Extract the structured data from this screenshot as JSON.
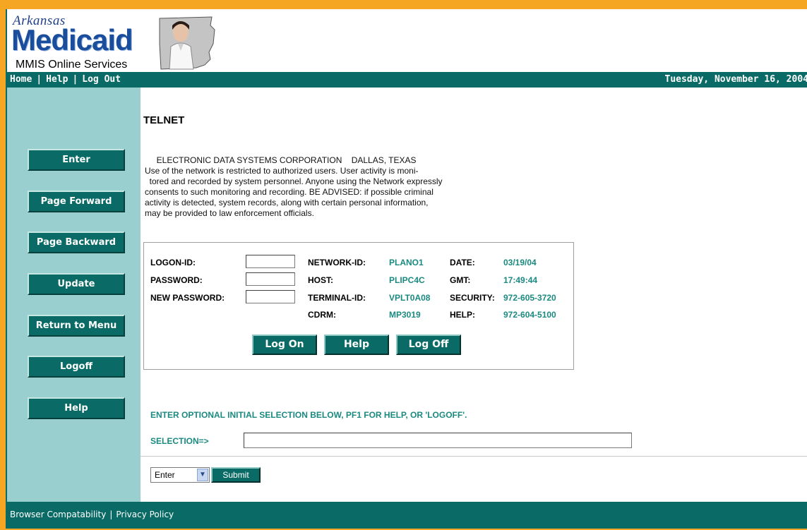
{
  "brand": {
    "script": "Arkansas",
    "name": "Medicaid",
    "subtitle": "MMIS Online Services"
  },
  "topbar": {
    "links": [
      "Home",
      "Help",
      "Log Out"
    ],
    "date": "Tuesday, November 16, 2004"
  },
  "sidebar": {
    "buttons": [
      "Enter",
      "Page Forward",
      "Page Backward",
      "Update",
      "Return to Menu",
      "Logoff",
      "Help"
    ]
  },
  "main": {
    "title": "TELNET",
    "notice": [
      "     ELECTRONIC DATA SYSTEMS CORPORATION    DALLAS, TEXAS",
      "Use of the network is restricted to authorized users. User activity is moni-",
      "  tored and recorded by system personnel. Anyone using the Network expressly",
      "consents to such monitoring and recording. BE ADVISED: if possible criminal",
      "activity is detected, system records, along with certain personal information,",
      "may be provided to law enforcement officials."
    ],
    "login": {
      "logon_id_label": "LOGON-ID:",
      "logon_id_value": "",
      "password_label": "PASSWORD:",
      "password_value": "",
      "new_password_label": "NEW PASSWORD:",
      "new_password_value": ""
    },
    "info": {
      "network_id_label": "NETWORK-ID:",
      "network_id": "PLANO1",
      "host_label": "HOST:",
      "host": "PLIPC4C",
      "terminal_id_label": "TERMINAL-ID:",
      "terminal_id": "VPLT0A08",
      "cdrm_label": "CDRM:",
      "cdrm": "MP3019",
      "date_label": "DATE:",
      "date": "03/19/04",
      "gmt_label": "GMT:",
      "gmt": "17:49:44",
      "security_label": "SECURITY:",
      "security": "972-605-3720",
      "help_label": "HELP:",
      "help": "972-604-5100"
    },
    "buttons": {
      "log_on": "Log On",
      "help": "Help",
      "log_off": "Log Off"
    },
    "prompt": "ENTER OPTIONAL INITIAL SELECTION BELOW, PF1 FOR HELP, OR 'LOGOFF'.",
    "selection_label": "SELECTION=>",
    "selection_value": "",
    "action_select": "Enter",
    "submit_label": "Submit"
  },
  "footer": {
    "links": [
      "Browser Compatability",
      "Privacy Policy"
    ]
  },
  "colors": {
    "teal": "#0a6b66",
    "sidebar": "#9acfcf",
    "value_text": "#1a8a80",
    "outer": "#f5a623"
  }
}
